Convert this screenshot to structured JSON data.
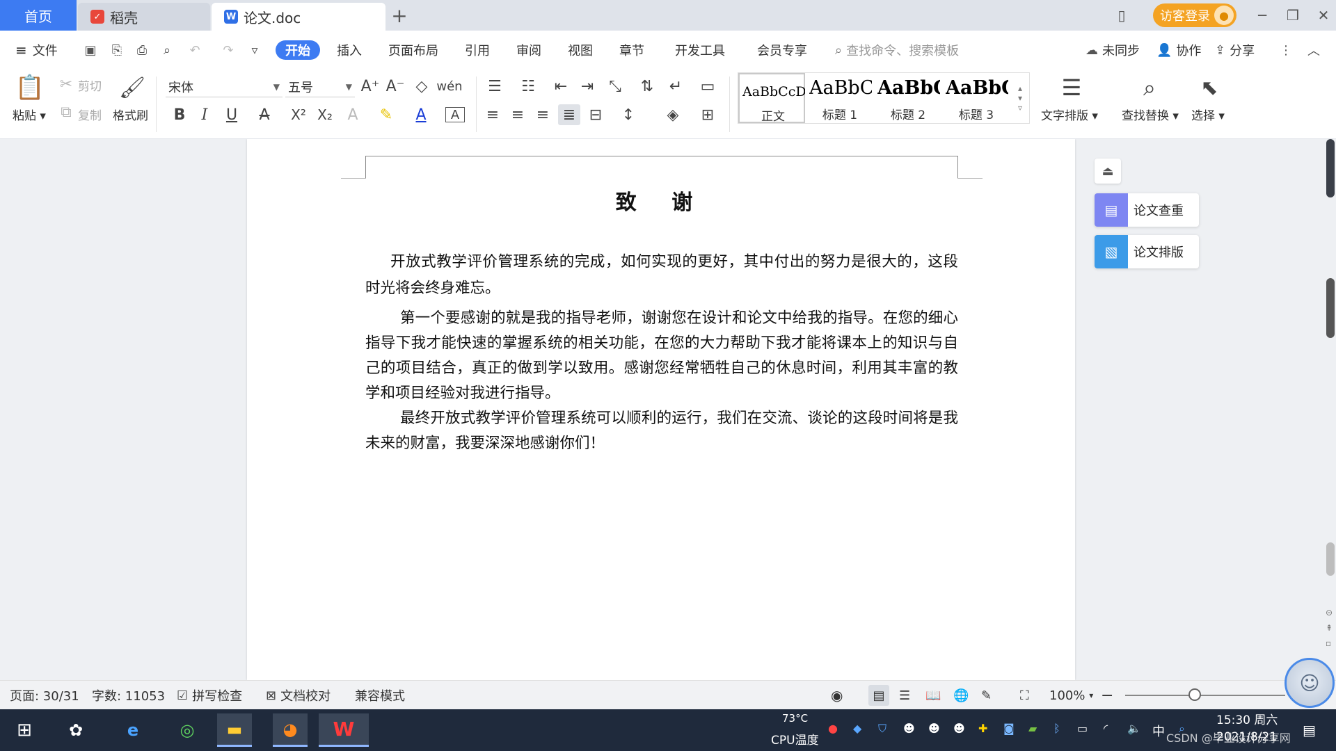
{
  "titlebar": {
    "home_tab": "首页",
    "tabs": [
      {
        "label": "稻壳",
        "icon": "docer-icon"
      },
      {
        "label": "论文.doc",
        "icon": "wps-writer-icon"
      }
    ],
    "guest_login": "访客登录"
  },
  "menubar": {
    "file": "文件",
    "tabs": [
      "开始",
      "插入",
      "页面布局",
      "引用",
      "审阅",
      "视图",
      "章节",
      "开发工具",
      "会员专享"
    ],
    "active_tab": "开始",
    "search_placeholder": "查找命令、搜索模板",
    "sync": "未同步",
    "collaborate": "协作",
    "share": "分享"
  },
  "ribbon": {
    "paste": "粘贴",
    "cut": "剪切",
    "copy": "复制",
    "format_painter": "格式刷",
    "font_name": "宋体",
    "font_size": "五号",
    "styles": [
      {
        "sample": "AaBbCcDd",
        "name": "正文"
      },
      {
        "sample": "AaBbC",
        "name": "标题 1"
      },
      {
        "sample": "AaBbC",
        "name": "标题 2"
      },
      {
        "sample": "AaBbC",
        "name": "标题 3"
      }
    ],
    "text_layout": "文字排版",
    "find_replace": "查找替换",
    "select": "选择"
  },
  "document": {
    "title": "致 谢",
    "paragraphs": [
      "开放式教学评价管理系统的完成，如何实现的更好，其中付出的努力是很大的，这段时光将会终身难忘。",
      "第一个要感谢的就是我的指导老师，谢谢您在设计和论文中给我的指导。在您的细心指导下我才能快速的掌握系统的相关功能，在您的大力帮助下我才能将课本上的知识与自己的项目结合，真正的做到学以致用。感谢您经常牺牲自己的休息时间，利用其丰富的教学和项目经验对我进行指导。",
      "最终开放式教学评价管理系统可以顺利的运行，我们在交流、谈论的这段时间将是我未来的财富，我要深深地感谢你们！"
    ]
  },
  "side_panel": {
    "check": "论文查重",
    "format": "论文排版"
  },
  "statusbar": {
    "page": "页面: 30/31",
    "word_count": "字数: 11053",
    "spell_check": "拼写检查",
    "proofread": "文档校对",
    "compat_mode": "兼容模式",
    "zoom": "100%"
  },
  "taskbar": {
    "cpu_temp": "73°C",
    "cpu_label": "CPU温度",
    "ime": "中",
    "time": "15:30 周六",
    "date": "2021/8/21"
  },
  "watermark": "CSDN @毕业设计分享网",
  "colors": {
    "accent": "#3d7bf2",
    "guest": "#f4a323",
    "taskbar": "#1f2a3c"
  }
}
